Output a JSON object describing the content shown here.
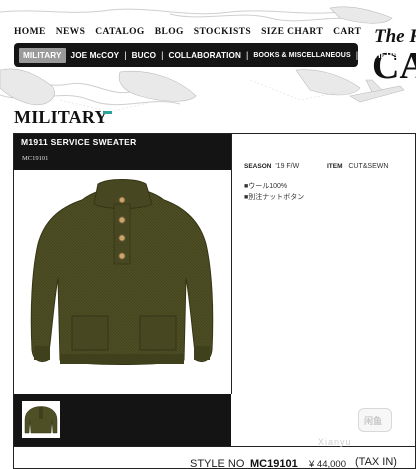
{
  "topnav": {
    "items": [
      "HOME",
      "NEWS",
      "CATALOG",
      "BLOG",
      "STOCKISTS",
      "SIZE CHART",
      "CART"
    ]
  },
  "catbar": {
    "items": [
      "MILITARY",
      "JOE McCOY",
      "BUCO",
      "COLLABORATION",
      "BOOKS & MISCELLANEOUS",
      "OTHERS"
    ],
    "active": "MILITARY"
  },
  "logo": {
    "line1": "The R",
    "line2": "CA"
  },
  "section": {
    "title": "MILITARY"
  },
  "product": {
    "name": "M1911 SERVICE SWEATER",
    "code": "MC19101",
    "season_label": "SEASON",
    "season_value": "'19 F/W",
    "item_label": "ITEM",
    "item_value": "CUT&SEWN",
    "material": "■ウール100%",
    "detail": "■別注ナットボタン",
    "style_label": "STYLE NO",
    "style_value": "MC19101",
    "price": "¥ 44,000",
    "tax": "(TAX IN)",
    "color": "#4a4a22"
  },
  "watermark": {
    "badge": "闲鱼",
    "text": "Xianyu"
  }
}
